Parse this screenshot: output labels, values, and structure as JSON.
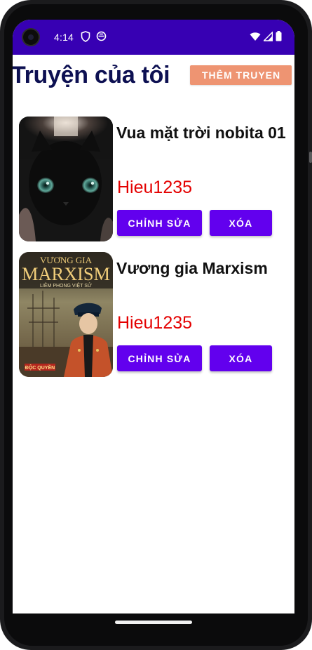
{
  "status_bar": {
    "time": "4:14"
  },
  "header": {
    "title": "Truyện của tôi",
    "add_button": "THÊM TRUYEN"
  },
  "stories": [
    {
      "title": " Vua mặt trời nobita 01",
      "author": "Hieu1235",
      "edit_label": "CHỈNH SỬA",
      "delete_label": "XÓA"
    },
    {
      "title": "Vương gia Marxism",
      "author": "Hieu1235",
      "edit_label": "CHỈNH SỬA",
      "delete_label": "XÓA",
      "cover_text": {
        "top": "VƯƠNG GIA",
        "main": "MARXISM",
        "sub": "LIÊM PHONG VIỆT SỬ",
        "badge": "ĐỘC QUYỀN"
      }
    }
  ],
  "colors": {
    "status_bar": "#3700B3",
    "primary_button": "#6200EE",
    "add_button": "#ee9472",
    "author_text": "#e40000",
    "title_text": "#0d1052"
  }
}
